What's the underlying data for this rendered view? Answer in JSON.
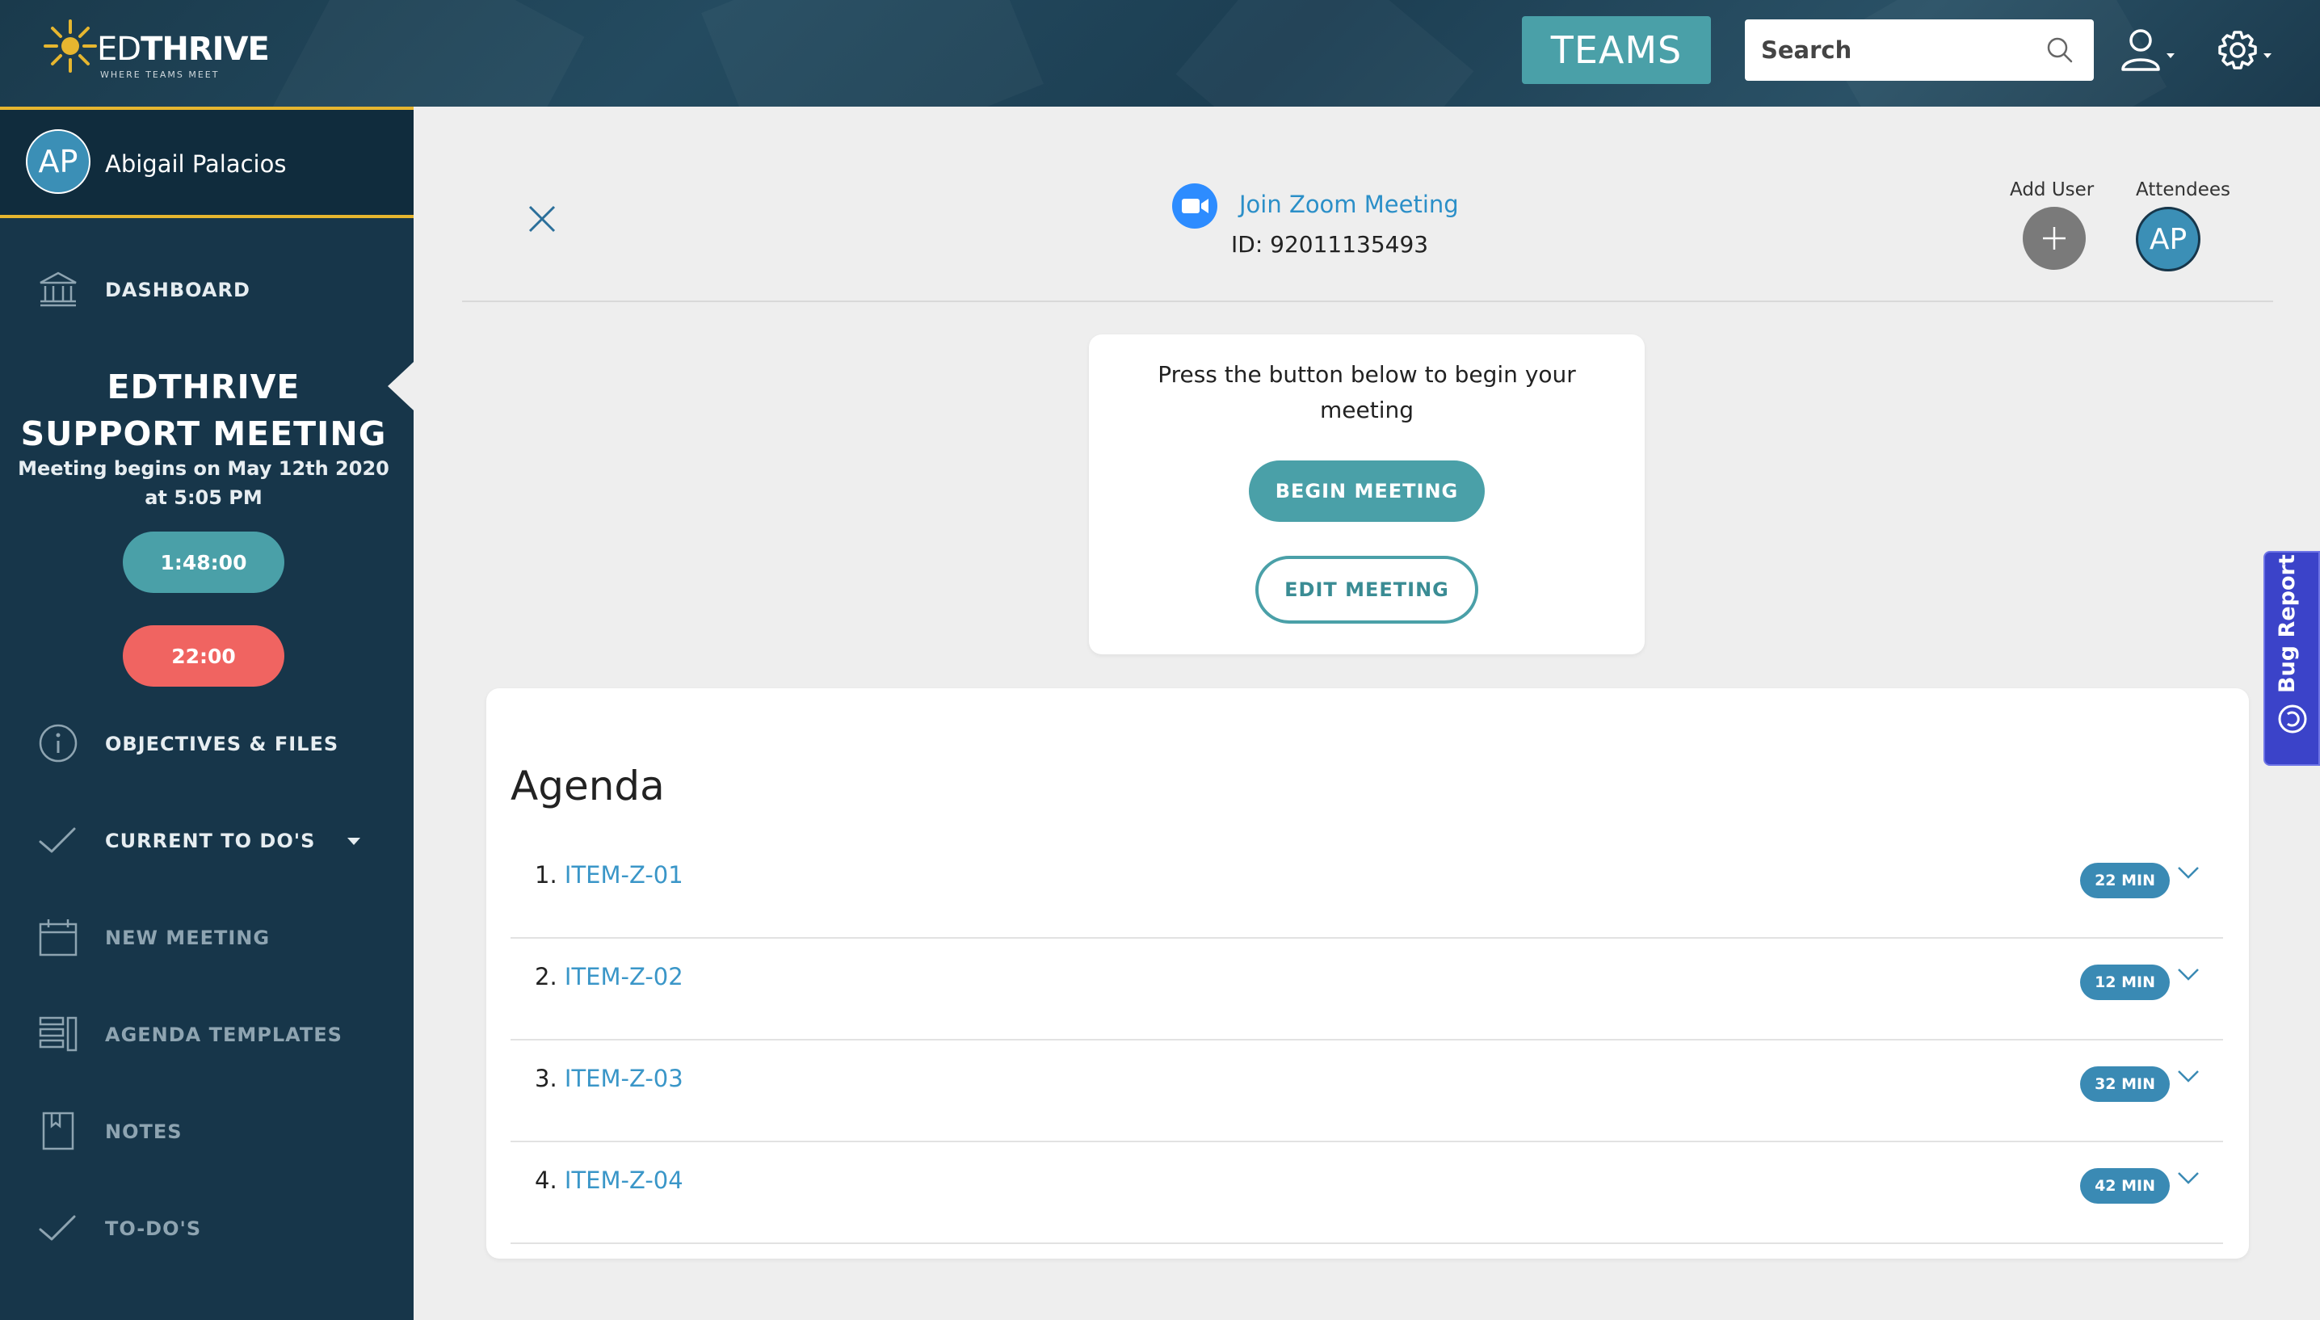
{
  "brand": {
    "logo_ed": "ED",
    "logo_thrive": "THRIVE",
    "tagline": "WHERE TEAMS MEET"
  },
  "header": {
    "teams_label": "TEAMS",
    "search_placeholder": "Search"
  },
  "user": {
    "initials": "AP",
    "name": "Abigail Palacios"
  },
  "sidebar": {
    "dashboard_label": "DASHBOARD",
    "meeting_title_line1": "EDTHRIVE",
    "meeting_title_line2": "SUPPORT MEETING",
    "meeting_begins_line1": "Meeting begins on May 12th 2020",
    "meeting_begins_line2": "at 5:05 PM",
    "timer_total": "1:48:00",
    "timer_remaining": "22:00",
    "items": [
      {
        "label": "OBJECTIVES & FILES"
      },
      {
        "label": "CURRENT TO DO'S"
      },
      {
        "label": "NEW MEETING"
      },
      {
        "label": "AGENDA TEMPLATES"
      },
      {
        "label": "NOTES"
      },
      {
        "label": "TO-DO'S"
      }
    ]
  },
  "meeting": {
    "zoom_link_label": "Join Zoom Meeting",
    "zoom_id": "ID: 92011135493",
    "add_user_label": "Add User",
    "attendees_label": "Attendees",
    "attendee_initials": "AP",
    "begin_prompt": "Press the button below to begin your meeting",
    "begin_button": "BEGIN MEETING",
    "edit_button": "EDIT MEETING"
  },
  "agenda": {
    "title": "Agenda",
    "items": [
      {
        "number": "1.",
        "name": "ITEM-Z-01",
        "duration": "22 MIN"
      },
      {
        "number": "2.",
        "name": "ITEM-Z-02",
        "duration": "12 MIN"
      },
      {
        "number": "3.",
        "name": "ITEM-Z-03",
        "duration": "32 MIN"
      },
      {
        "number": "4.",
        "name": "ITEM-Z-04",
        "duration": "42 MIN"
      }
    ]
  },
  "bug_report": {
    "label": "Bug Report"
  },
  "colors": {
    "header_bg": "#1e4256",
    "sidebar_bg": "#17364a",
    "accent_teal": "#4aa0a8",
    "accent_red": "#f06461",
    "accent_gold": "#e6b62f",
    "link_blue": "#3a96c8",
    "bug_tab": "#3b43c9"
  },
  "icons": {
    "logo": "sun-logo-icon",
    "search": "search-icon",
    "user": "user-icon",
    "settings": "gear-icon",
    "dashboard": "building-icon",
    "objectives": "info-icon",
    "todos": "check-icon",
    "new_meeting": "calendar-icon",
    "templates": "list-icon",
    "notes": "notebook-icon",
    "close": "close-icon",
    "zoom": "video-camera-icon",
    "add_user": "plus-icon",
    "chevron": "chevron-down-icon"
  }
}
